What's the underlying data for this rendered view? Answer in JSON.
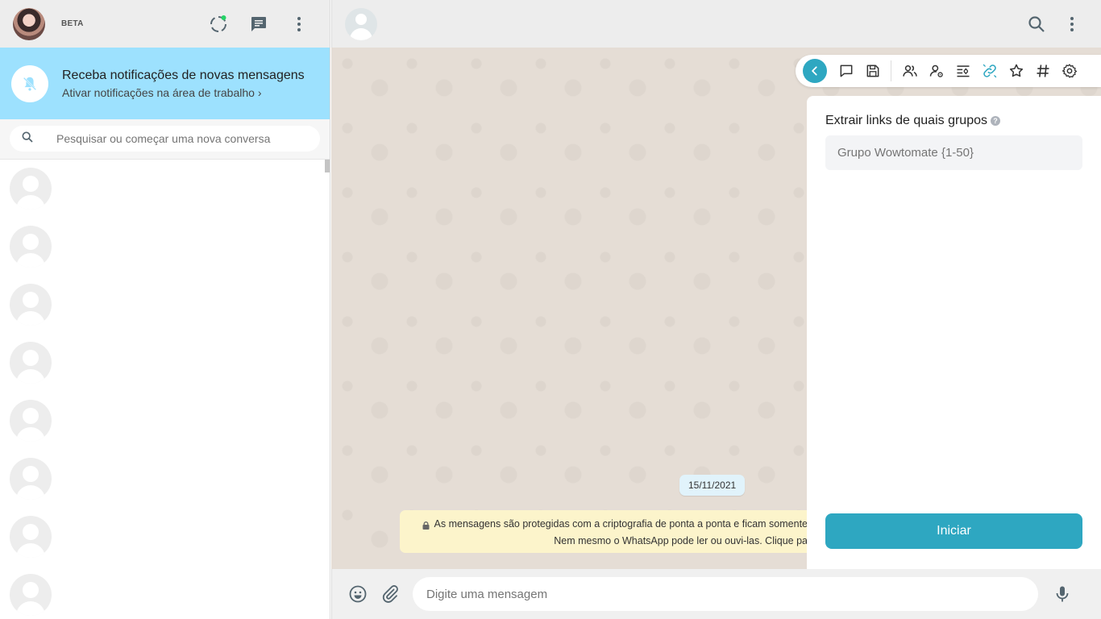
{
  "sidebar": {
    "beta_label": "BETA",
    "notification": {
      "title": "Receba notificações de novas mensagens",
      "subtitle": "Ativar notificações na área de trabalho"
    },
    "search": {
      "placeholder": "Pesquisar ou começar uma nova conversa"
    },
    "chat_placeholders": 8
  },
  "chat": {
    "date_chip": "15/11/2021",
    "encryption_line1": "As mensagens são protegidas com a criptografia de ponta a ponta e ficam somente",
    "encryption_line2": "Nem mesmo o WhatsApp pode ler ou ouvi-las. Clique pa",
    "composer_placeholder": "Digite uma mensagem"
  },
  "extension": {
    "toolbar_icons": [
      "back-icon",
      "chat-bubble-icon",
      "save-icon",
      "users-icon",
      "user-settings-icon",
      "filter-list-icon",
      "link-icon",
      "star-icon",
      "hashtag-icon",
      "gear-icon"
    ],
    "field_label": "Extrair links de quais grupos",
    "help_symbol": "?",
    "field_placeholder": "Grupo Wowtomate {1-50}",
    "start_button": "Iniciar",
    "accent_color": "#2ea7c1"
  },
  "colors": {
    "notification_bg": "#9de1fe",
    "header_bg": "#ededed",
    "chat_bg": "#e5ddd5"
  }
}
